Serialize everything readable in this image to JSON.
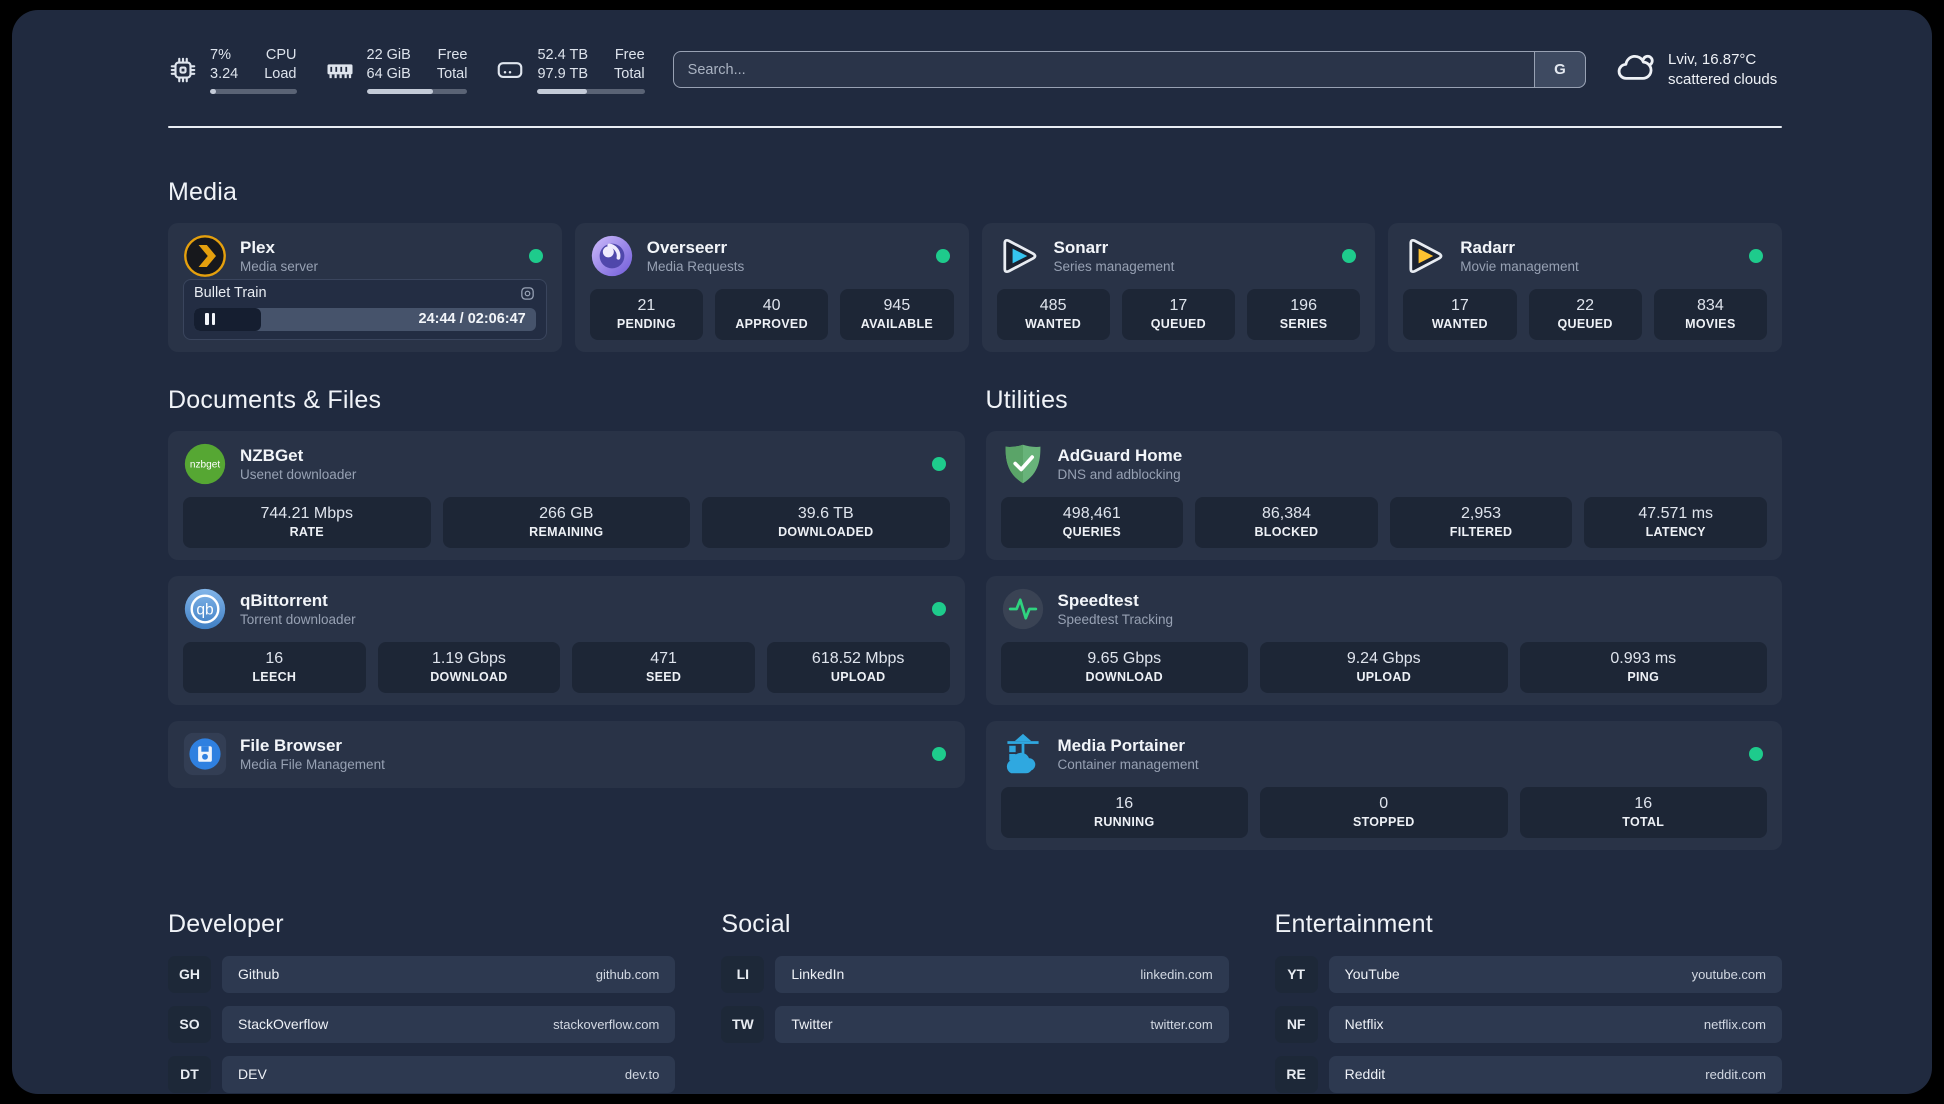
{
  "topbar": {
    "cpu": {
      "values": [
        "7%",
        "3.24"
      ],
      "labels": [
        "CPU",
        "Load"
      ],
      "progress_pct": 7
    },
    "memory": {
      "values": [
        "22 GiB",
        "64 GiB"
      ],
      "labels": [
        "Free",
        "Total"
      ],
      "progress_pct": 66
    },
    "storage": {
      "values": [
        "52.4 TB",
        "97.9 TB"
      ],
      "labels": [
        "Free",
        "Total"
      ],
      "progress_pct": 46
    },
    "search": {
      "placeholder": "Search...",
      "engine_label": "G"
    },
    "weather": {
      "location": "Lviv, 16.87°C",
      "condition": "scattered clouds"
    }
  },
  "sections": [
    {
      "id": "media",
      "heading": "Media",
      "apps": [
        {
          "name": "Plex",
          "subtitle": "Media server",
          "icon": "plex-icon",
          "status_dot": true,
          "player": {
            "title": "Bullet Train",
            "time": "24:44 / 02:06:47",
            "progress_pct": 19.6
          }
        },
        {
          "name": "Overseerr",
          "subtitle": "Media Requests",
          "icon": "overseerr-icon",
          "status_dot": true,
          "stats": [
            {
              "value": "21",
              "label": "PENDING"
            },
            {
              "value": "40",
              "label": "APPROVED"
            },
            {
              "value": "945",
              "label": "AVAILABLE"
            }
          ]
        },
        {
          "name": "Sonarr",
          "subtitle": "Series management",
          "icon": "sonarr-icon",
          "status_dot": true,
          "stats": [
            {
              "value": "485",
              "label": "WANTED"
            },
            {
              "value": "17",
              "label": "QUEUED"
            },
            {
              "value": "196",
              "label": "SERIES"
            }
          ]
        },
        {
          "name": "Radarr",
          "subtitle": "Movie management",
          "icon": "radarr-icon",
          "status_dot": true,
          "stats": [
            {
              "value": "17",
              "label": "WANTED"
            },
            {
              "value": "22",
              "label": "QUEUED"
            },
            {
              "value": "834",
              "label": "MOVIES"
            }
          ]
        }
      ]
    },
    {
      "id": "documents",
      "heading": "Documents & Files",
      "apps": [
        {
          "name": "NZBGet",
          "subtitle": "Usenet downloader",
          "icon": "nzbget-icon",
          "status_dot": true,
          "stats": [
            {
              "value": "744.21 Mbps",
              "label": "RATE"
            },
            {
              "value": "266 GB",
              "label": "REMAINING"
            },
            {
              "value": "39.6 TB",
              "label": "DOWNLOADED"
            }
          ]
        },
        {
          "name": "qBittorrent",
          "subtitle": "Torrent downloader",
          "icon": "qbittorrent-icon",
          "status_dot": true,
          "stats": [
            {
              "value": "16",
              "label": "LEECH"
            },
            {
              "value": "1.19 Gbps",
              "label": "DOWNLOAD"
            },
            {
              "value": "471",
              "label": "SEED"
            },
            {
              "value": "618.52 Mbps",
              "label": "UPLOAD"
            }
          ]
        },
        {
          "name": "File Browser",
          "subtitle": "Media File Management",
          "icon": "filebrowser-icon",
          "status_dot": true
        }
      ]
    },
    {
      "id": "utilities",
      "heading": "Utilities",
      "apps": [
        {
          "name": "AdGuard Home",
          "subtitle": "DNS and adblocking",
          "icon": "adguard-icon",
          "status_dot": false,
          "stats": [
            {
              "value": "498,461",
              "label": "QUERIES"
            },
            {
              "value": "86,384",
              "label": "BLOCKED"
            },
            {
              "value": "2,953",
              "label": "FILTERED"
            },
            {
              "value": "47.571 ms",
              "label": "LATENCY"
            }
          ]
        },
        {
          "name": "Speedtest",
          "subtitle": "Speedtest Tracking",
          "icon": "speedtest-icon",
          "status_dot": false,
          "stats": [
            {
              "value": "9.65 Gbps",
              "label": "DOWNLOAD"
            },
            {
              "value": "9.24 Gbps",
              "label": "UPLOAD"
            },
            {
              "value": "0.993 ms",
              "label": "PING"
            }
          ]
        },
        {
          "name": "Media Portainer",
          "subtitle": "Container management",
          "icon": "portainer-icon",
          "status_dot": true,
          "stats": [
            {
              "value": "16",
              "label": "RUNNING"
            },
            {
              "value": "0",
              "label": "STOPPED"
            },
            {
              "value": "16",
              "label": "TOTAL"
            }
          ]
        }
      ]
    }
  ],
  "link_sections": [
    {
      "heading": "Developer",
      "links": [
        {
          "badge": "GH",
          "name": "Github",
          "url": "github.com"
        },
        {
          "badge": "SO",
          "name": "StackOverflow",
          "url": "stackoverflow.com"
        },
        {
          "badge": "DT",
          "name": "DEV",
          "url": "dev.to"
        }
      ]
    },
    {
      "heading": "Social",
      "links": [
        {
          "badge": "LI",
          "name": "LinkedIn",
          "url": "linkedin.com"
        },
        {
          "badge": "TW",
          "name": "Twitter",
          "url": "twitter.com"
        }
      ]
    },
    {
      "heading": "Entertainment",
      "links": [
        {
          "badge": "YT",
          "name": "YouTube",
          "url": "youtube.com"
        },
        {
          "badge": "NF",
          "name": "Netflix",
          "url": "netflix.com"
        },
        {
          "badge": "RE",
          "name": "Reddit",
          "url": "reddit.com"
        }
      ]
    }
  ]
}
